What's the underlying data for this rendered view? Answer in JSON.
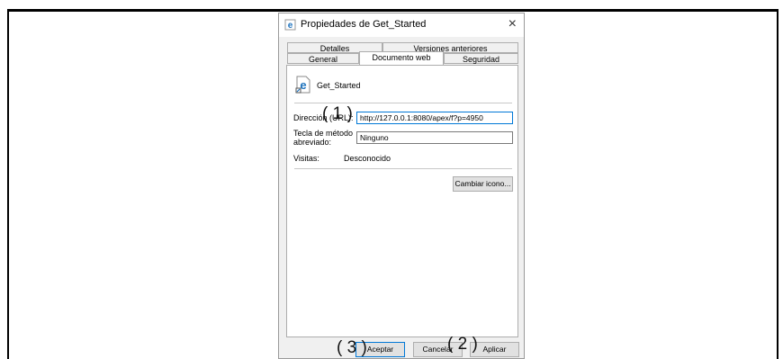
{
  "dialog": {
    "title": "Propiedades de Get_Started",
    "close_glyph": "×",
    "tabs_row1": [
      "Detalles",
      "Versiones anteriores"
    ],
    "tabs_row2": [
      "General",
      "Documento web",
      "Seguridad"
    ],
    "active_tab": "Documento web"
  },
  "page": {
    "file_name": "Get_Started",
    "url_label": "Dirección (URL):",
    "url_value": "http://127.0.0.1:8080/apex/f?p=4950",
    "shortcut_label_1": "Tecla de método",
    "shortcut_label_2": "abreviado:",
    "shortcut_value": "Ninguno",
    "visits_label": "Visitas:",
    "visits_value": "Desconocido",
    "change_icon_label": "Cambiar icono..."
  },
  "buttons": {
    "accept": "Aceptar",
    "cancel": "Cancelar",
    "apply": "Aplicar"
  },
  "callouts": {
    "one": "( 1 )",
    "two": "( 2 )",
    "three": "( 3 )"
  },
  "colors": {
    "accent": "#0078d7",
    "ie_blue": "#1e73be"
  }
}
